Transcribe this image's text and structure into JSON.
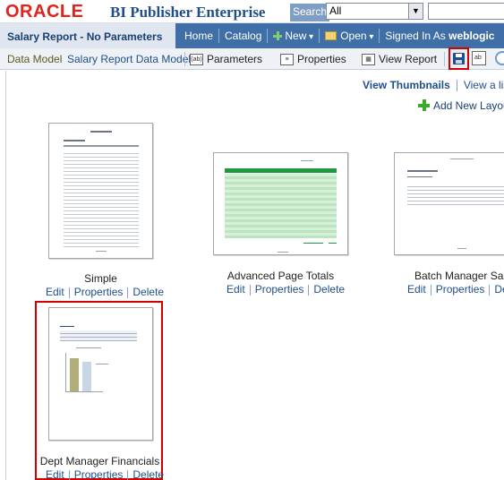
{
  "topbar": {
    "logo": "ORACLE",
    "product": "BI Publisher Enterprise",
    "search_label": "Search",
    "search_scope": "All",
    "search_value": ""
  },
  "header": {
    "report_title": "Salary Report - No Parameters",
    "nav": {
      "home": "Home",
      "catalog": "Catalog",
      "new": "New",
      "open": "Open",
      "signed_in_as": "Signed In As",
      "user": "weblogic"
    }
  },
  "toolbar": {
    "data_model_label": "Data Model",
    "data_model_name": "Salary Report Data Model",
    "parameters": "Parameters",
    "properties": "Properties",
    "view_report": "View Report"
  },
  "view_options": {
    "thumbnails": "View Thumbnails",
    "list": "View a list"
  },
  "add_layout": "Add New Layout",
  "layouts": [
    {
      "name": "Simple",
      "actions": [
        "Edit",
        "Properties",
        "Delete"
      ]
    },
    {
      "name": "Advanced Page Totals",
      "actions": [
        "Edit",
        "Properties",
        "Delete"
      ]
    },
    {
      "name": "Batch Manager Salary",
      "actions": [
        "Edit",
        "Properties",
        "Delete"
      ]
    },
    {
      "name": "Dept Manager Financials",
      "actions": [
        "Edit",
        "Properties",
        "Delete"
      ]
    }
  ],
  "colors": {
    "brand_red": "#e2231a",
    "header_blue": "#3f6fa6",
    "link_blue": "#1f4e8c",
    "highlight_red": "#d40000"
  }
}
